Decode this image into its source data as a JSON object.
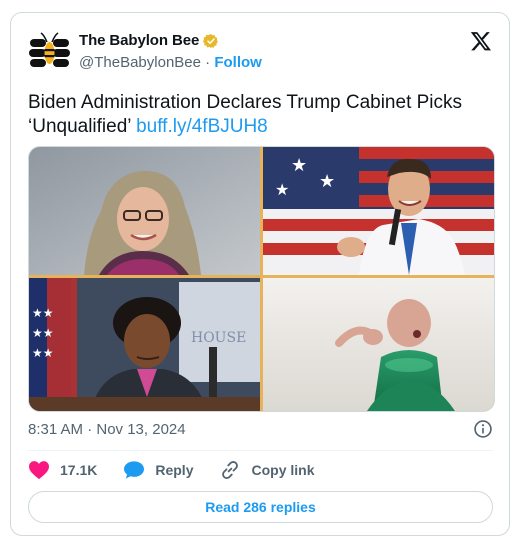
{
  "author": {
    "display_name": "The Babylon Bee",
    "handle": "@TheBabylonBee",
    "separator": " · ",
    "follow_label": "Follow",
    "avatar_icon": "babylon-bee-logo",
    "verified_icon": "gold-verified-badge"
  },
  "platform": {
    "logo_icon": "x-logo"
  },
  "tweet": {
    "text": "Biden Administration Declares Trump Cabinet Picks ‘Unqualified’ ",
    "link": "buff.ly/4fBJUH8"
  },
  "media": {
    "layout": "2x2-photo-grid",
    "border_color": "#e6b35a"
  },
  "meta": {
    "timestamp": "8:31 AM · Nov 13, 2024",
    "info_icon": "info-icon"
  },
  "actions": {
    "like_count": "17.1K",
    "like_icon": "heart-icon",
    "reply_label": "Reply",
    "reply_icon": "speech-bubble-icon",
    "copy_label": "Copy link",
    "copy_icon": "link-icon"
  },
  "footer": {
    "read_replies_label": "Read 286 replies"
  },
  "colors": {
    "accent": "#1d9bf0",
    "like": "#f91880",
    "text": "#0f1419",
    "muted": "#536471",
    "border": "#cfd9de"
  }
}
